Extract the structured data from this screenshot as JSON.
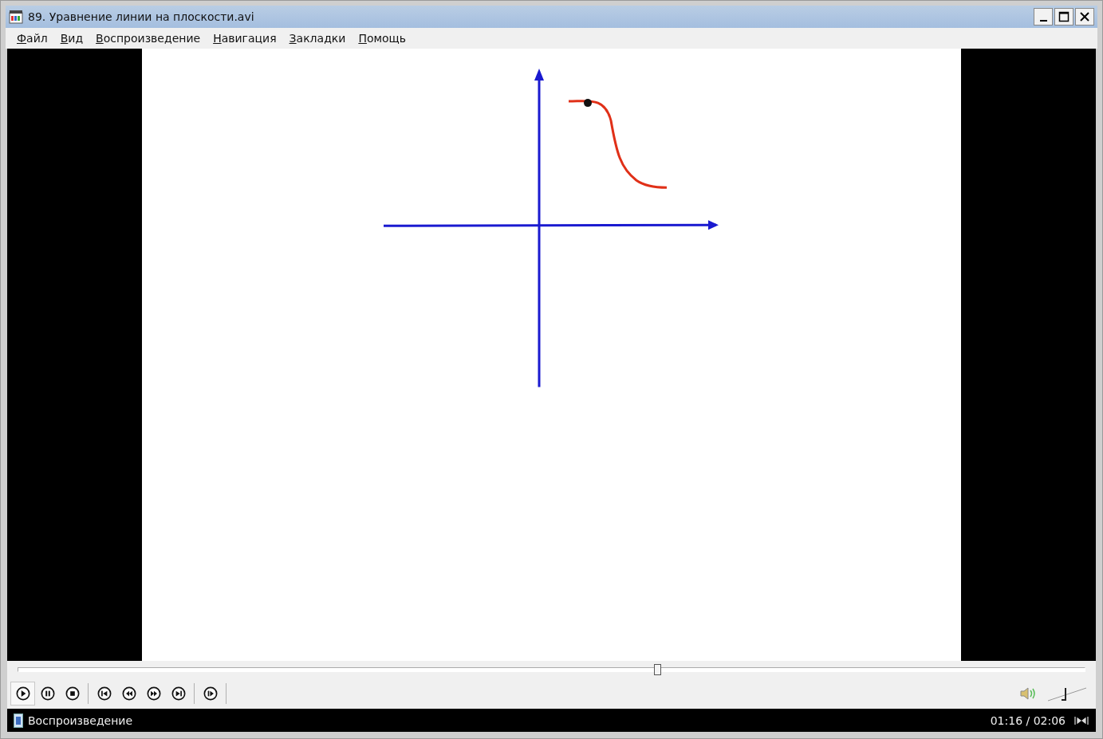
{
  "window": {
    "title": "89. Уравнение линии на плоскости.avi"
  },
  "menu": [
    "Файл",
    "Вид",
    "Воспроизведение",
    "Навигация",
    "Закладки",
    "Помощь"
  ],
  "seek": {
    "level": 0.6
  },
  "controls": [
    {
      "kind": "play",
      "selected": true
    },
    {
      "kind": "pause",
      "selected": false
    },
    {
      "kind": "stop",
      "selected": false
    },
    {
      "kind": "separator"
    },
    {
      "kind": "previous",
      "selected": false
    },
    {
      "kind": "rewind",
      "selected": false
    },
    {
      "kind": "forward",
      "selected": false
    },
    {
      "kind": "next",
      "selected": false
    },
    {
      "kind": "separator"
    },
    {
      "kind": "frame-step",
      "selected": false
    },
    {
      "kind": "separator"
    }
  ],
  "volume": {
    "level": 0.42
  },
  "status_bar": {
    "text": "Воспроизведение",
    "time": "01:16 / 02:06"
  }
}
